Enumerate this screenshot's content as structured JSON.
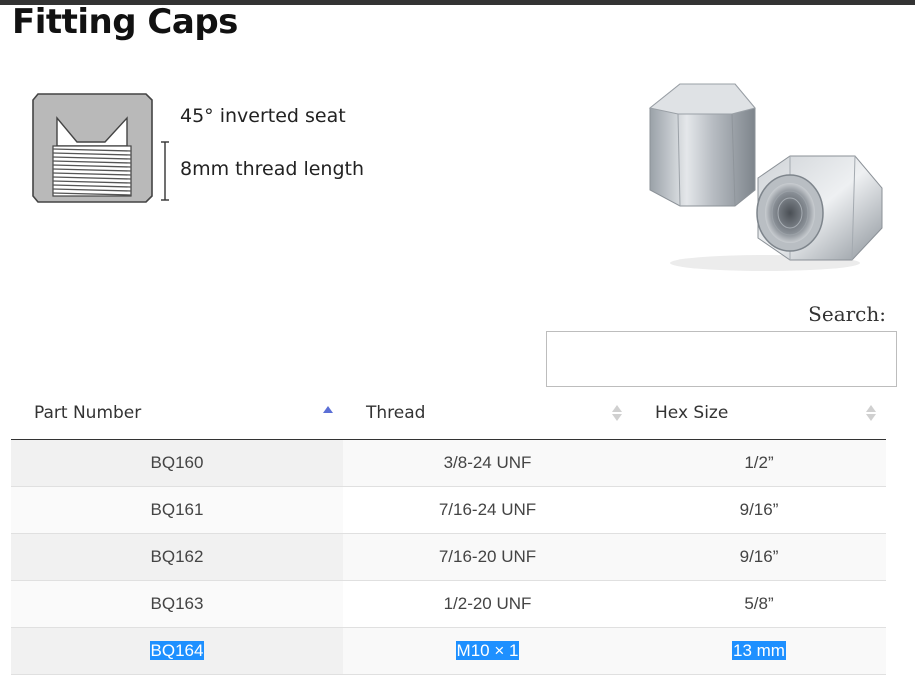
{
  "page": {
    "title": "Fitting Caps",
    "specs": [
      "45° inverted seat",
      "8mm thread length"
    ]
  },
  "search": {
    "label": "Search:",
    "value": ""
  },
  "table": {
    "columns": [
      "Part Number",
      "Thread",
      "Hex Size"
    ],
    "sorted_column": "Part Number",
    "rows": [
      {
        "part": "BQ160",
        "thread": "3/8-24 UNF",
        "hex": "1/2”"
      },
      {
        "part": "BQ161",
        "thread": "7/16-24 UNF",
        "hex": "9/16”"
      },
      {
        "part": "BQ162",
        "thread": "7/16-20 UNF",
        "hex": "9/16”"
      },
      {
        "part": "BQ163",
        "thread": "1/2-20 UNF",
        "hex": "5/8”"
      },
      {
        "part": "BQ164",
        "thread": "M10 × 1",
        "hex": "13 mm",
        "selected": true
      }
    ]
  },
  "colors": {
    "accent": "#5b6fd6",
    "selection": "#1e90ff",
    "header_rule": "#333333"
  }
}
